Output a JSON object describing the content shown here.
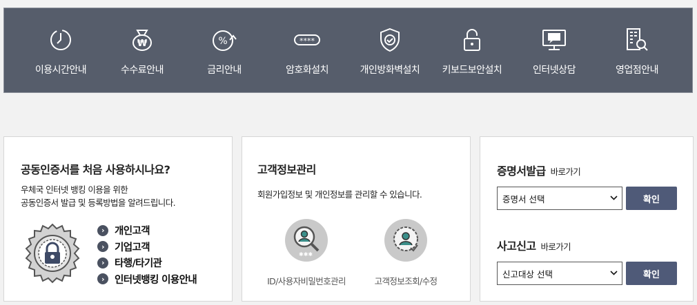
{
  "topnav": {
    "items": [
      {
        "label": "이용시간안내",
        "icon": "clock-icon"
      },
      {
        "label": "수수료안내",
        "icon": "money-bag-icon"
      },
      {
        "label": "금리안내",
        "icon": "interest-rate-icon"
      },
      {
        "label": "암호화설치",
        "icon": "password-field-icon"
      },
      {
        "label": "개인방화벽설치",
        "icon": "shield-check-icon"
      },
      {
        "label": "키보드보안설치",
        "icon": "padlock-icon"
      },
      {
        "label": "인터넷상담",
        "icon": "monitor-chat-icon"
      },
      {
        "label": "영업점안내",
        "icon": "building-search-icon"
      }
    ]
  },
  "cert": {
    "title": "공동인증서를 처음 사용하시나요?",
    "desc_line1": "우체국 인터넷 뱅킹 이용을 위한",
    "desc_line2": "공동인증서 발급 및 등록방법을 알려드립니다.",
    "seal_icon": "certificate-seal-icon",
    "links": [
      "개인고객",
      "기업고객",
      "타행/타기관",
      "인터넷뱅킹 이용안내"
    ]
  },
  "customer": {
    "title": "고객정보관리",
    "desc": "회원가입정보 및 개인정보를 관리할 수 있습니다.",
    "items": [
      {
        "label": "ID/사용자비밀번호관리",
        "icon": "user-search-icon"
      },
      {
        "label": "고객정보조회/수정",
        "icon": "user-edit-icon"
      }
    ]
  },
  "shortcuts": {
    "cert_issue_title": "증명서발급",
    "cert_issue_sub": "바로가기",
    "cert_issue_select": "증명서 선택",
    "report_title": "사고신고",
    "report_sub": "바로가기",
    "report_select": "신고대상 선택",
    "confirm": "확인"
  },
  "colors": {
    "topbar": "#565d6b",
    "button": "#4f5a78",
    "arrow": "#4a5160"
  }
}
